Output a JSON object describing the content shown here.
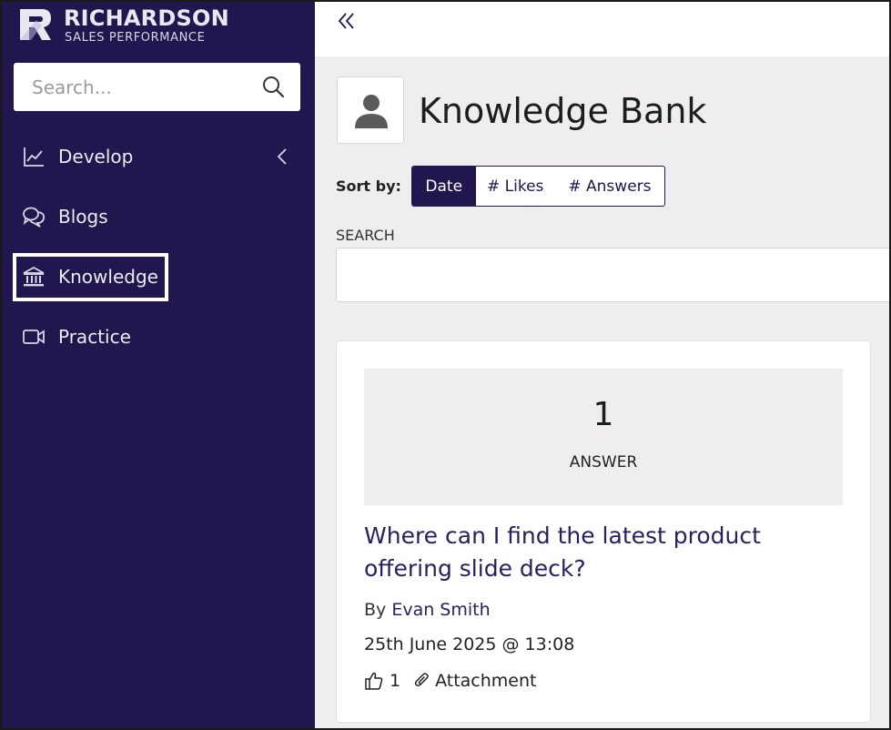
{
  "brand": {
    "name_line1": "RICHARDSON",
    "name_line2": "SALES PERFORMANCE"
  },
  "sidebar": {
    "search_placeholder": "Search...",
    "items": [
      {
        "label": "Develop",
        "icon": "chart-line-icon",
        "has_submenu": true
      },
      {
        "label": "Blogs",
        "icon": "chat-bubbles-icon"
      },
      {
        "label": "Knowledge",
        "icon": "bank-icon",
        "highlighted": true
      },
      {
        "label": "Practice",
        "icon": "video-camera-icon"
      }
    ]
  },
  "main": {
    "title": "Knowledge Bank",
    "sort": {
      "label": "Sort by:",
      "options": [
        {
          "label": "Date",
          "active": true
        },
        {
          "label": "# Likes",
          "active": false
        },
        {
          "label": "# Answers",
          "active": false
        }
      ]
    },
    "search_label": "SEARCH",
    "card": {
      "answer_count": "1",
      "answer_label": "ANSWER",
      "title": "Where can I find the latest product offering slide deck?",
      "author_prefix": "By",
      "author": "Evan Smith",
      "date": "25th June 2025 @ 13:08",
      "likes": "1",
      "attachment_label": "Attachment"
    }
  },
  "colors": {
    "sidebar_bg": "#21174e",
    "main_bg": "#efeded",
    "accent": "#21174e",
    "link": "#2a2060"
  }
}
